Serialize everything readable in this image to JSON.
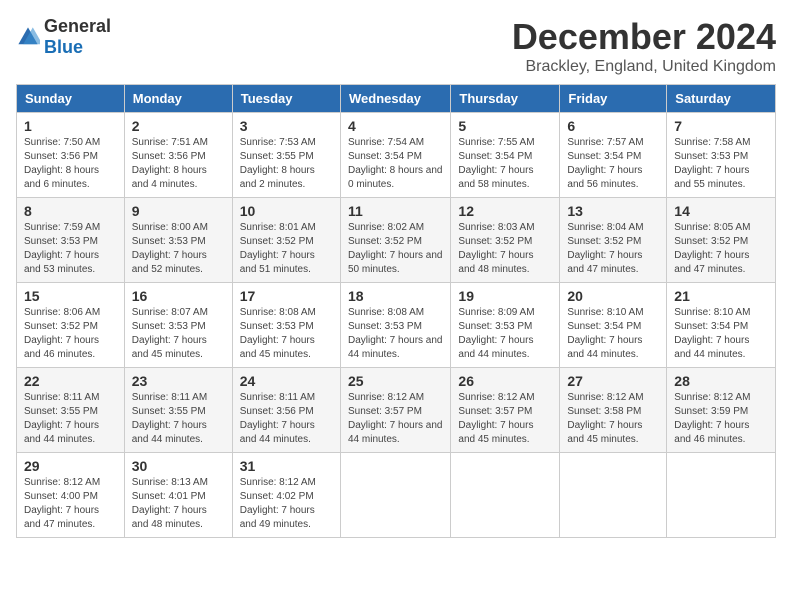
{
  "logo": {
    "general": "General",
    "blue": "Blue"
  },
  "title": "December 2024",
  "location": "Brackley, England, United Kingdom",
  "headers": [
    "Sunday",
    "Monday",
    "Tuesday",
    "Wednesday",
    "Thursday",
    "Friday",
    "Saturday"
  ],
  "weeks": [
    [
      {
        "day": "1",
        "sunrise": "7:50 AM",
        "sunset": "3:56 PM",
        "daylight": "8 hours and 6 minutes."
      },
      {
        "day": "2",
        "sunrise": "7:51 AM",
        "sunset": "3:56 PM",
        "daylight": "8 hours and 4 minutes."
      },
      {
        "day": "3",
        "sunrise": "7:53 AM",
        "sunset": "3:55 PM",
        "daylight": "8 hours and 2 minutes."
      },
      {
        "day": "4",
        "sunrise": "7:54 AM",
        "sunset": "3:54 PM",
        "daylight": "8 hours and 0 minutes."
      },
      {
        "day": "5",
        "sunrise": "7:55 AM",
        "sunset": "3:54 PM",
        "daylight": "7 hours and 58 minutes."
      },
      {
        "day": "6",
        "sunrise": "7:57 AM",
        "sunset": "3:54 PM",
        "daylight": "7 hours and 56 minutes."
      },
      {
        "day": "7",
        "sunrise": "7:58 AM",
        "sunset": "3:53 PM",
        "daylight": "7 hours and 55 minutes."
      }
    ],
    [
      {
        "day": "8",
        "sunrise": "7:59 AM",
        "sunset": "3:53 PM",
        "daylight": "7 hours and 53 minutes."
      },
      {
        "day": "9",
        "sunrise": "8:00 AM",
        "sunset": "3:53 PM",
        "daylight": "7 hours and 52 minutes."
      },
      {
        "day": "10",
        "sunrise": "8:01 AM",
        "sunset": "3:52 PM",
        "daylight": "7 hours and 51 minutes."
      },
      {
        "day": "11",
        "sunrise": "8:02 AM",
        "sunset": "3:52 PM",
        "daylight": "7 hours and 50 minutes."
      },
      {
        "day": "12",
        "sunrise": "8:03 AM",
        "sunset": "3:52 PM",
        "daylight": "7 hours and 48 minutes."
      },
      {
        "day": "13",
        "sunrise": "8:04 AM",
        "sunset": "3:52 PM",
        "daylight": "7 hours and 47 minutes."
      },
      {
        "day": "14",
        "sunrise": "8:05 AM",
        "sunset": "3:52 PM",
        "daylight": "7 hours and 47 minutes."
      }
    ],
    [
      {
        "day": "15",
        "sunrise": "8:06 AM",
        "sunset": "3:52 PM",
        "daylight": "7 hours and 46 minutes."
      },
      {
        "day": "16",
        "sunrise": "8:07 AM",
        "sunset": "3:53 PM",
        "daylight": "7 hours and 45 minutes."
      },
      {
        "day": "17",
        "sunrise": "8:08 AM",
        "sunset": "3:53 PM",
        "daylight": "7 hours and 45 minutes."
      },
      {
        "day": "18",
        "sunrise": "8:08 AM",
        "sunset": "3:53 PM",
        "daylight": "7 hours and 44 minutes."
      },
      {
        "day": "19",
        "sunrise": "8:09 AM",
        "sunset": "3:53 PM",
        "daylight": "7 hours and 44 minutes."
      },
      {
        "day": "20",
        "sunrise": "8:10 AM",
        "sunset": "3:54 PM",
        "daylight": "7 hours and 44 minutes."
      },
      {
        "day": "21",
        "sunrise": "8:10 AM",
        "sunset": "3:54 PM",
        "daylight": "7 hours and 44 minutes."
      }
    ],
    [
      {
        "day": "22",
        "sunrise": "8:11 AM",
        "sunset": "3:55 PM",
        "daylight": "7 hours and 44 minutes."
      },
      {
        "day": "23",
        "sunrise": "8:11 AM",
        "sunset": "3:55 PM",
        "daylight": "7 hours and 44 minutes."
      },
      {
        "day": "24",
        "sunrise": "8:11 AM",
        "sunset": "3:56 PM",
        "daylight": "7 hours and 44 minutes."
      },
      {
        "day": "25",
        "sunrise": "8:12 AM",
        "sunset": "3:57 PM",
        "daylight": "7 hours and 44 minutes."
      },
      {
        "day": "26",
        "sunrise": "8:12 AM",
        "sunset": "3:57 PM",
        "daylight": "7 hours and 45 minutes."
      },
      {
        "day": "27",
        "sunrise": "8:12 AM",
        "sunset": "3:58 PM",
        "daylight": "7 hours and 45 minutes."
      },
      {
        "day": "28",
        "sunrise": "8:12 AM",
        "sunset": "3:59 PM",
        "daylight": "7 hours and 46 minutes."
      }
    ],
    [
      {
        "day": "29",
        "sunrise": "8:12 AM",
        "sunset": "4:00 PM",
        "daylight": "7 hours and 47 minutes."
      },
      {
        "day": "30",
        "sunrise": "8:13 AM",
        "sunset": "4:01 PM",
        "daylight": "7 hours and 48 minutes."
      },
      {
        "day": "31",
        "sunrise": "8:12 AM",
        "sunset": "4:02 PM",
        "daylight": "7 hours and 49 minutes."
      },
      null,
      null,
      null,
      null
    ]
  ]
}
